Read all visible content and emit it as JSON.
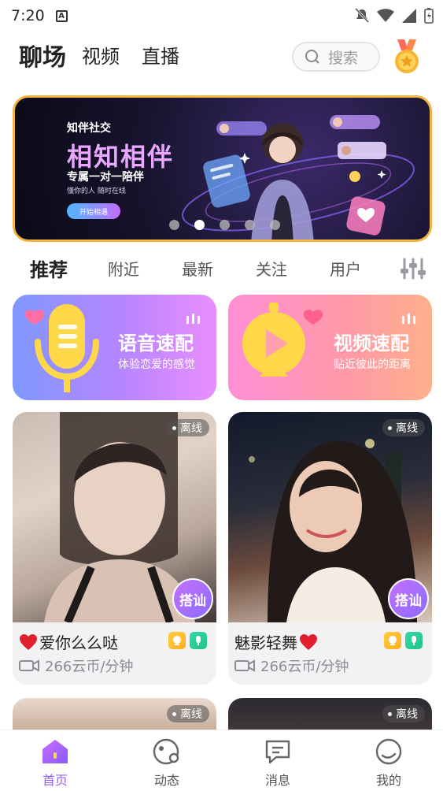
{
  "status": {
    "time": "7:20"
  },
  "header": {
    "tabs": [
      {
        "label": "聊场"
      },
      {
        "label": "视频"
      },
      {
        "label": "直播"
      }
    ],
    "search_placeholder": "搜索"
  },
  "banner": {
    "kicker": "知伴社交",
    "title": "相知相伴",
    "subtitle": "专属一对一陪伴",
    "tagline": "懂你的人 随时在线",
    "button": "开始相遇",
    "page_count": 5,
    "active_page": 2
  },
  "subtabs": [
    {
      "label": "推荐"
    },
    {
      "label": "附近"
    },
    {
      "label": "最新"
    },
    {
      "label": "关注"
    },
    {
      "label": "用户"
    }
  ],
  "promos": {
    "voice": {
      "title": "语音速配",
      "subtitle": "体验恋爱的感觉"
    },
    "video": {
      "title": "视频速配",
      "subtitle": "贴近彼此的距离"
    }
  },
  "cards": [
    {
      "status": "离线",
      "action": "搭讪",
      "name": "爱你么么哒",
      "price": "266云币/分钟"
    },
    {
      "status": "离线",
      "action": "搭讪",
      "name": "魅影轻舞",
      "price": "266云币/分钟"
    },
    {
      "status": "离线"
    },
    {
      "status": "离线"
    }
  ],
  "nav": [
    {
      "label": "首页"
    },
    {
      "label": "动态"
    },
    {
      "label": "消息"
    },
    {
      "label": "我的"
    }
  ],
  "colors": {
    "accent": "#9b5cff",
    "banner_border": "#f4b53f"
  }
}
